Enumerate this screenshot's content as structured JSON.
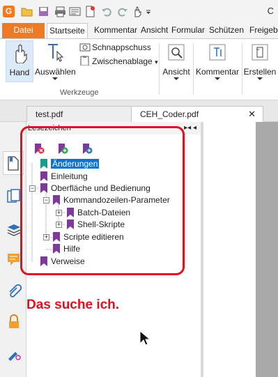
{
  "app": {
    "title_fragment": "C",
    "accent_color": "#ef7a22",
    "logo_letter": "G"
  },
  "ribbon_tabs": [
    "Datei",
    "Startseite",
    "Kommentar",
    "Ansicht",
    "Formular",
    "Schützen",
    "Freigeben"
  ],
  "ribbon": {
    "hand_label": "Hand",
    "select_label": "Auswählen",
    "snapshot_label": "Schnappschuss",
    "clipboard_label": "Zwischenablage",
    "group_label": "Werkzeuge",
    "view_label": "Ansicht",
    "comment_label": "Kommentar",
    "create_label": "Erstellen"
  },
  "document_tabs": [
    {
      "label": "test.pdf",
      "active": false
    },
    {
      "label": "CEH_Coder.pdf",
      "active": true
    }
  ],
  "bookmarks": {
    "header_title": "Lesezeichen",
    "items": [
      {
        "label": "Änderungen",
        "level": 0,
        "selected": true
      },
      {
        "label": "Einleitung",
        "level": 0
      },
      {
        "label": "Oberfläche und Bedienung",
        "level": 0,
        "expander": "−"
      },
      {
        "label": "Kommandozeilen-Parameter",
        "level": 1,
        "expander": "−"
      },
      {
        "label": "Batch-Dateien",
        "level": 2,
        "expander": "+"
      },
      {
        "label": "Shell-Skripte",
        "level": 2,
        "expander": "+"
      },
      {
        "label": "Scripte editieren",
        "level": 1,
        "expander": "+"
      },
      {
        "label": "Hilfe",
        "level": 1
      },
      {
        "label": "Verweise",
        "level": 0
      }
    ]
  },
  "annotation": {
    "text": "Das suche ich.",
    "color": "#e0101e"
  }
}
